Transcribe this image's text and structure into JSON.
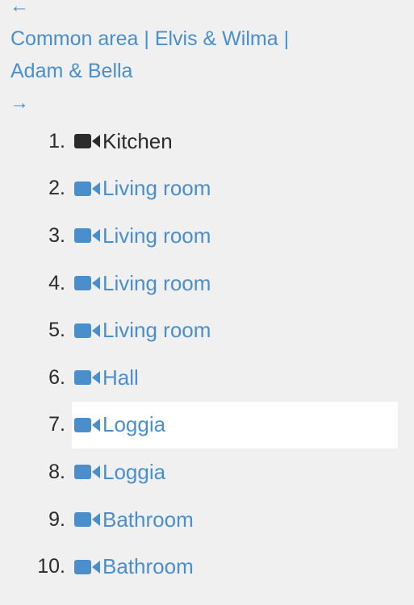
{
  "nav": {
    "prev_symbol": "←",
    "next_symbol": "→"
  },
  "breadcrumb": {
    "items": [
      "Common area",
      "Elvis & Wilma",
      "Adam & Bella"
    ],
    "separator": "|"
  },
  "colors": {
    "link": "#4a8fcc",
    "text": "#2b2b2b",
    "background": "#f0f0f0",
    "highlight": "#ffffff"
  },
  "cameras": [
    {
      "number": "1.",
      "label": "Kitchen",
      "icon": "video-camera-icon",
      "active": true
    },
    {
      "number": "2.",
      "label": "Living room",
      "icon": "video-camera-icon"
    },
    {
      "number": "3.",
      "label": "Living room",
      "icon": "video-camera-icon"
    },
    {
      "number": "4.",
      "label": "Living room",
      "icon": "video-camera-icon"
    },
    {
      "number": "5.",
      "label": "Living room",
      "icon": "video-camera-icon"
    },
    {
      "number": "6.",
      "label": "Hall",
      "icon": "video-camera-icon"
    },
    {
      "number": "7.",
      "label": "Loggia",
      "icon": "video-camera-icon",
      "highlighted": true
    },
    {
      "number": "8.",
      "label": "Loggia",
      "icon": "video-camera-icon"
    },
    {
      "number": "9.",
      "label": "Bathroom",
      "icon": "video-camera-icon"
    },
    {
      "number": "10.",
      "label": "Bathroom",
      "icon": "video-camera-icon"
    }
  ]
}
